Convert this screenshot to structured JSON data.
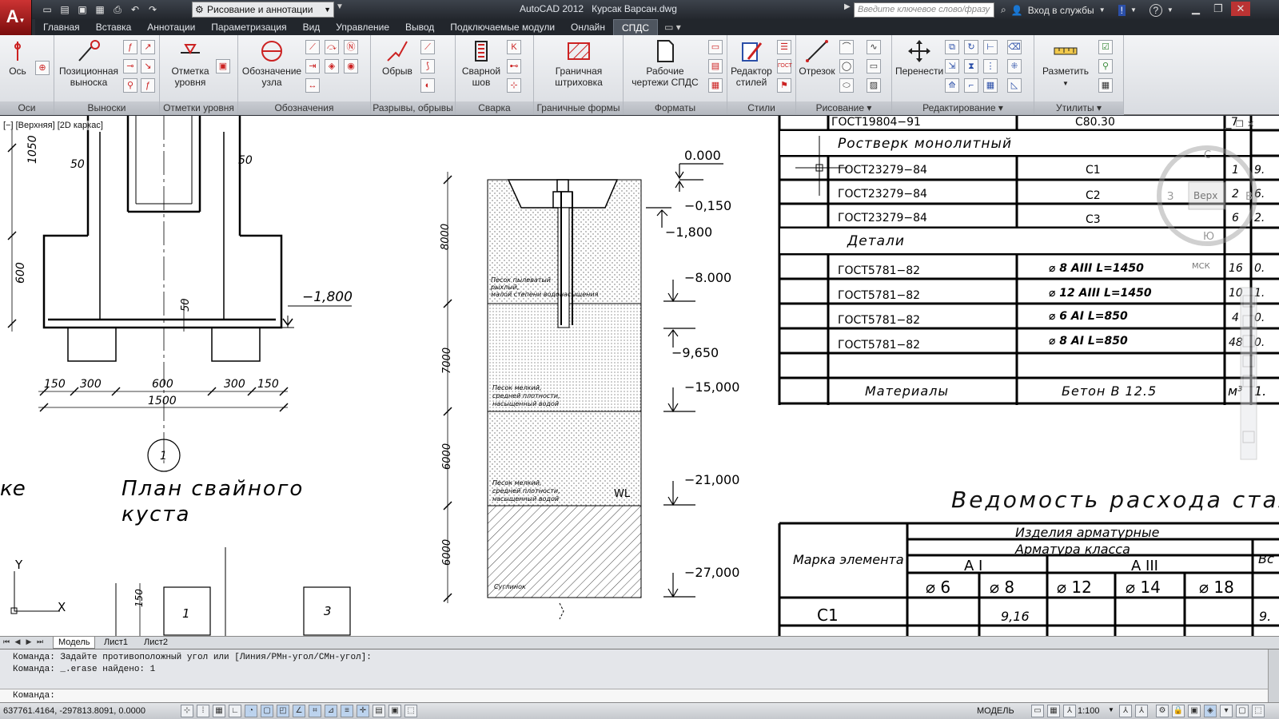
{
  "titlebar": {
    "workspace": "Рисование и аннотации",
    "app_name": "AutoCAD 2012",
    "file_name": "Курсак Варсан.dwg",
    "search_placeholder": "Введите ключевое слово/фразу",
    "signin": "Вход в службы"
  },
  "tabs": [
    "Главная",
    "Вставка",
    "Аннотации",
    "Параметризация",
    "Вид",
    "Управление",
    "Вывод",
    "Подключаемые модули",
    "Онлайн",
    "СПДС"
  ],
  "active_tab": "СПДС",
  "ribbon": {
    "axis": "Ось",
    "pos_leader_1": "Позиционная",
    "pos_leader_2": "выноска",
    "level_1": "Отметка",
    "level_2": "уровня",
    "node_1": "Обозначение",
    "node_2": "узла",
    "break": "Обрыв",
    "weld_1": "Сварной",
    "weld_2": "шов",
    "hatch_1": "Граничная",
    "hatch_2": "штриховка",
    "sheets_1": "Рабочие",
    "sheets_2": "чертежи СПДС",
    "styles_1": "Редактор",
    "styles_2": "стилей",
    "segment": "Отрезок",
    "move": "Перенести",
    "place": "Разметить",
    "panels": [
      "Оси",
      "Выноски",
      "Отметки уровня",
      "Обозначения",
      "Разрывы, обрывы",
      "Сварка",
      "Граничные формы",
      "Форматы",
      "Стили",
      "Рисование",
      "Редактирование",
      "Утилиты"
    ]
  },
  "viewport": {
    "label": "[−] [Верхняя] [2D каркас]",
    "viewcube_top": "Верх",
    "viewcube_n": "С",
    "viewcube_s": "Ю",
    "viewcube_w": "З",
    "viewcube_e": "В",
    "wcs": "МСК"
  },
  "drawing": {
    "plan_title_1": "План  свайного",
    "plan_title_2": "куста",
    "plan_prefix": "ке",
    "circle_num": "1",
    "dims_left": [
      "1050",
      "600"
    ],
    "dim_50a": "50",
    "dim_50b": "50",
    "dim_50c": "50",
    "dims_bottom": [
      "150",
      "300",
      "600",
      "300",
      "150"
    ],
    "dim_total": "1500",
    "level_plan": "−1,800",
    "small_box_1": "1",
    "small_box_3": "3",
    "dim_150": "150",
    "axis_y": "Y",
    "axis_x": "X",
    "section_dims": [
      "8000",
      "7000",
      "6000",
      "6000"
    ],
    "section_levels": [
      "0.000",
      "−0,150",
      "−1,800",
      "−8.000",
      "−9,650",
      "−15,000",
      "−21,000",
      "−27,000"
    ],
    "soil_1_1": "Песок пылеватый",
    "soil_1_2": "рыхлый,",
    "soil_1_3": "малой степени водонасыщения",
    "soil_2_1": "Песок мелкий,",
    "soil_2_2": "средней плотности,",
    "soil_2_3": "насыщенный водой",
    "soil_3_1": "Песок мелкий,",
    "soil_3_2": "средней плотности,",
    "soil_3_3": "насыщенный водой",
    "soil_4": "Суглинок",
    "wl": "WL"
  },
  "spec_table": {
    "rows": [
      {
        "doc": "ГОСТ19804−91",
        "name": "С80.30",
        "qty": "7",
        "mass": ""
      },
      {
        "doc": "Ростверк  монолитный",
        "name": "",
        "qty": "",
        "mass": "",
        "section": true
      },
      {
        "doc": "ГОСТ23279−84",
        "name": "С1",
        "qty": "1",
        "mass": "9."
      },
      {
        "doc": "ГОСТ23279−84",
        "name": "С2",
        "qty": "2",
        "mass": "6."
      },
      {
        "doc": "ГОСТ23279−84",
        "name": "С3",
        "qty": "6",
        "mass": "2."
      },
      {
        "doc": "Детали",
        "name": "",
        "qty": "",
        "mass": "",
        "section": true
      },
      {
        "doc": "ГОСТ5781−82",
        "name": "⌀  8  AIII  L=1450",
        "qty": "16",
        "mass": "0."
      },
      {
        "doc": "ГОСТ5781−82",
        "name": "⌀  12  AIII  L=1450",
        "qty": "10",
        "mass": "1."
      },
      {
        "doc": "ГОСТ5781−82",
        "name": "⌀  6  AI  L=850",
        "qty": "4",
        "mass": "0."
      },
      {
        "doc": "ГОСТ5781−82",
        "name": "⌀  8  AI  L=850",
        "qty": "48",
        "mass": "0."
      },
      {
        "doc": "",
        "name": "",
        "qty": "",
        "mass": ""
      },
      {
        "doc": "Материалы",
        "name": "Бетон  В 12.5",
        "qty": "м³",
        "mass": "1."
      }
    ]
  },
  "steel_table": {
    "title": "Ведомость  расхода  стали",
    "h_mark": "Марка  элемента",
    "h_products": "Изделия  арматурные",
    "h_class": "Арматура  класса",
    "h_ai": "A I",
    "h_aiii": "A III",
    "h_right": "Вс",
    "diameters": [
      "⌀ 6",
      "⌀ 8",
      "⌀ 12",
      "⌀ 14",
      "⌀ 18"
    ],
    "row_mark": "С1",
    "row_value_d8": "9,16",
    "row_right": "9."
  },
  "layout_tabs": [
    "Модель",
    "Лист1",
    "Лист2"
  ],
  "command": {
    "line1": "Команда: Задайте противоположный угол или [Линия/РМн-угол/СМн-угол]:",
    "line2": "Команда: _.erase найдено: 1",
    "prompt": "Команда:"
  },
  "status": {
    "coords": "637761.4164, -297813.8091, 0.0000",
    "model": "МОДЕЛЬ",
    "scale": "1:100"
  }
}
